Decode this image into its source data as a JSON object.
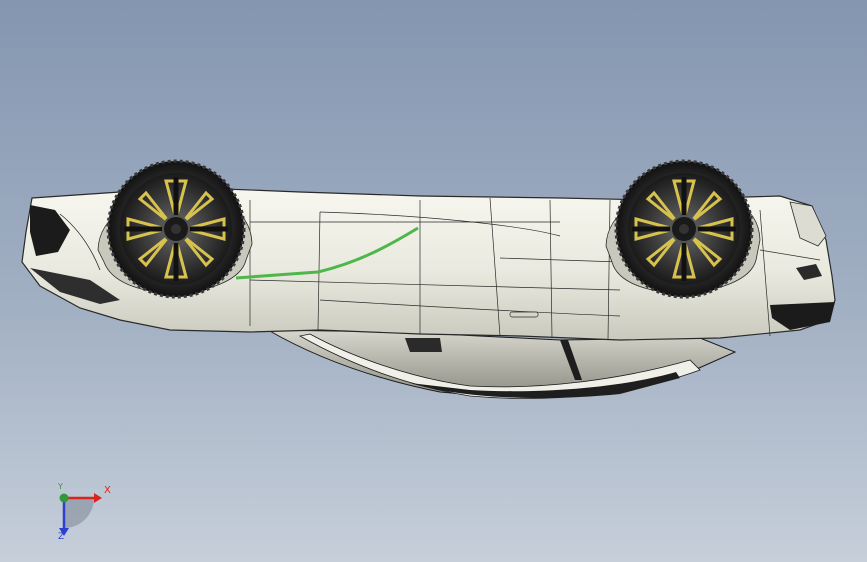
{
  "viewport": {
    "background_top": "#8496b0",
    "background_bottom": "#c6cfda"
  },
  "model": {
    "name": "car-model-upside-down",
    "body_color": "#eeeee4",
    "edge_color": "#2a2a2a",
    "accent_line_color": "#4fb64a",
    "rim_accent_color": "#d7c24e"
  },
  "triad": {
    "x_label": "X",
    "y_label": "Y",
    "z_label": "Z",
    "x_color": "#d8261e",
    "y_color": "#2f9a3a",
    "z_color": "#2d3fd0"
  }
}
